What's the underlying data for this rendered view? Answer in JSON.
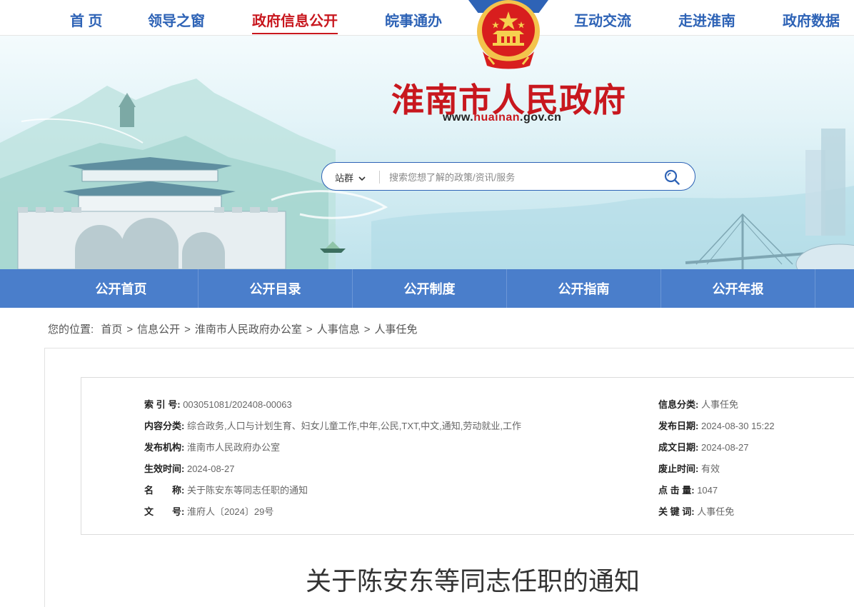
{
  "top_nav": {
    "items": [
      "首 页",
      "领导之窗",
      "政府信息公开",
      "皖事通办",
      "互动交流",
      "走进淮南",
      "政府数据"
    ],
    "active_index": 2
  },
  "header": {
    "site_title": "淮南市人民政府",
    "site_url_prefix": "www.",
    "site_url_highlight": "huainan",
    "site_url_suffix": ".gov.cn"
  },
  "search": {
    "scope_label": "站群",
    "placeholder": "搜索您想了解的政策/资讯/服务"
  },
  "sub_nav": {
    "items": [
      "公开首页",
      "公开目录",
      "公开制度",
      "公开指南",
      "公开年报"
    ]
  },
  "breadcrumb": {
    "label": "您的位置:",
    "items": [
      "首页",
      "信息公开",
      "淮南市人民政府办公室",
      "人事信息",
      "人事任免"
    ],
    "separator": ">"
  },
  "meta": {
    "left": [
      {
        "key": "索 引 号:",
        "value": "003051081/202408-00063"
      },
      {
        "key": "内容分类:",
        "value": "综合政务,人口与计划生育、妇女儿童工作,中年,公民,TXT,中文,通知,劳动就业,工作"
      },
      {
        "key": "发布机构:",
        "value": "淮南市人民政府办公室"
      },
      {
        "key": "生效时间:",
        "value": "2024-08-27"
      },
      {
        "key": "名　　称:",
        "value": "关于陈安东等同志任职的通知"
      },
      {
        "key": "文　　号:",
        "value": "淮府人〔2024〕29号"
      }
    ],
    "right": [
      {
        "key": "信息分类:",
        "value": "人事任免"
      },
      {
        "key": "发布日期:",
        "value": "2024-08-30 15:22"
      },
      {
        "key": "成文日期:",
        "value": "2024-08-27"
      },
      {
        "key": "废止时间:",
        "value": "有效"
      },
      {
        "key": "点 击 量:",
        "value": "1047"
      },
      {
        "key": "关 键 词:",
        "value": "人事任免"
      }
    ]
  },
  "document": {
    "title": "关于陈安东等同志任职的通知"
  },
  "colors": {
    "brand_blue": "#2e63b6",
    "subnav_blue": "#4a7ecb",
    "brand_red": "#c8171e"
  },
  "icons": {
    "emblem": "national-emblem-icon",
    "search": "search-icon",
    "dropdown": "chevron-down-icon"
  }
}
